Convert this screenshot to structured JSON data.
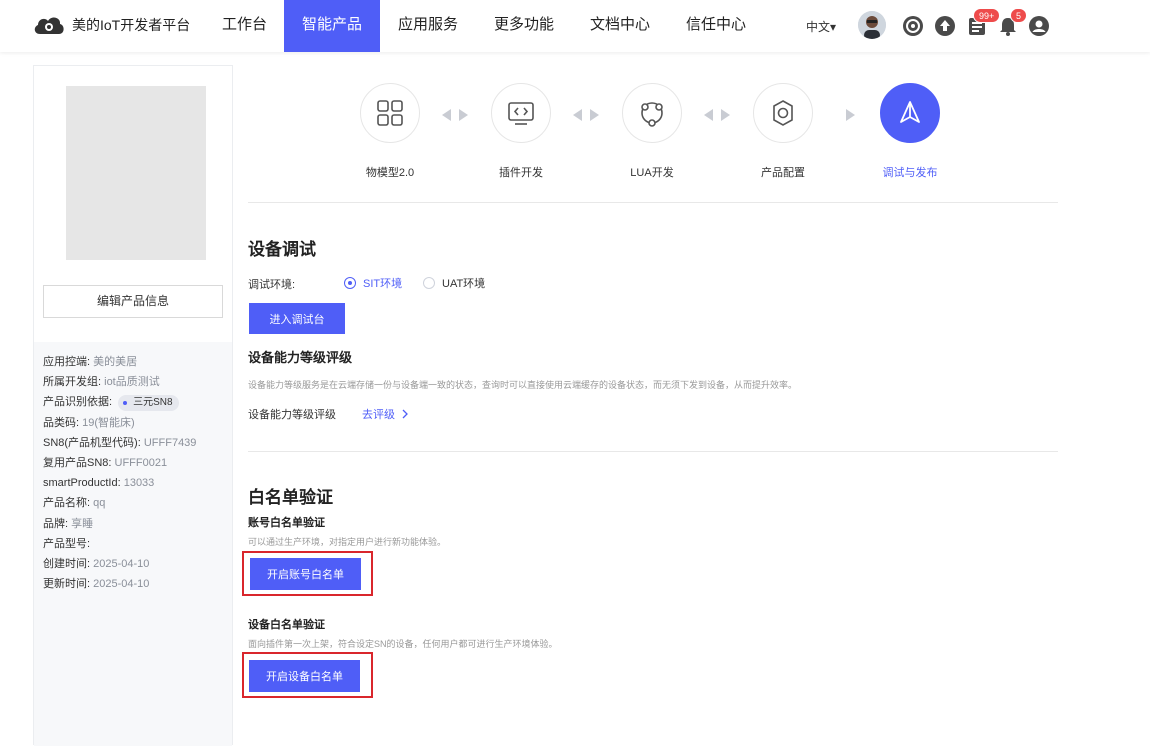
{
  "brand": {
    "name": "美的IoT开发者平台",
    "color": "#4f5ef7"
  },
  "nav": [
    {
      "label": "工作台"
    },
    {
      "label": "智能产品"
    },
    {
      "label": "应用服务"
    },
    {
      "label": "更多功能"
    },
    {
      "label": "文档中心"
    },
    {
      "label": "信任中心"
    }
  ],
  "header": {
    "language": "中文▾",
    "badges": {
      "tasks": "99+",
      "notifications": "5"
    }
  },
  "sidebar": {
    "edit_button": "编辑产品信息",
    "info": [
      {
        "key": "应用控端: ",
        "value": "美的美居"
      },
      {
        "key": "所属开发组: ",
        "value": "iot品质测试"
      },
      {
        "key": "产品识别依据: ",
        "value": "三元SN8",
        "chip": true
      },
      {
        "key": "品类码: ",
        "value": "19(智能床)"
      },
      {
        "key": "SN8(产品机型代码): ",
        "value": "UFFF7439"
      },
      {
        "key": "复用产品SN8: ",
        "value": "UFFF0021"
      },
      {
        "key": "smartProductId: ",
        "value": "13033"
      },
      {
        "key": "产品名称: ",
        "value": "qq"
      },
      {
        "key": "品牌: ",
        "value": "享睡"
      },
      {
        "key": "产品型号: ",
        "value": ""
      },
      {
        "key": "创建时间: ",
        "value": "2025-04-10"
      },
      {
        "key": "更新时间: ",
        "value": "2025-04-10"
      }
    ]
  },
  "steps": [
    {
      "label": "物模型2.0",
      "icon": "grid-icon"
    },
    {
      "label": "插件开发",
      "icon": "code-monitor-icon"
    },
    {
      "label": "LUA开发",
      "icon": "nodes-icon"
    },
    {
      "label": "产品配置",
      "icon": "gear-icon"
    },
    {
      "label": "调试与发布",
      "icon": "paper-plane-icon",
      "active": true
    }
  ],
  "debug": {
    "title": "设备调试",
    "env_label": "调试环境:",
    "env_options": [
      "SIT环境",
      "UAT环境"
    ],
    "env_selected": "SIT环境",
    "enter_button": "进入调试台",
    "level_title": "设备能力等级评级",
    "level_desc": "设备能力等级服务是在云端存储一份与设备端一致的状态，查询时可以直接使用云端缓存的设备状态，而无须下发到设备，从而提升效率。",
    "level_label": "设备能力等级评级",
    "level_link": "去评级"
  },
  "whitelist": {
    "title": "白名单验证",
    "account_title": "账号白名单验证",
    "account_desc": "可以通过生产环境，对指定用户进行新功能体验。",
    "account_button": "开启账号白名单",
    "device_title": "设备白名单验证",
    "device_desc": "面向插件第一次上架，符合设定SN的设备，任何用户都可进行生产环境体验。",
    "device_button": "开启设备白名单"
  }
}
